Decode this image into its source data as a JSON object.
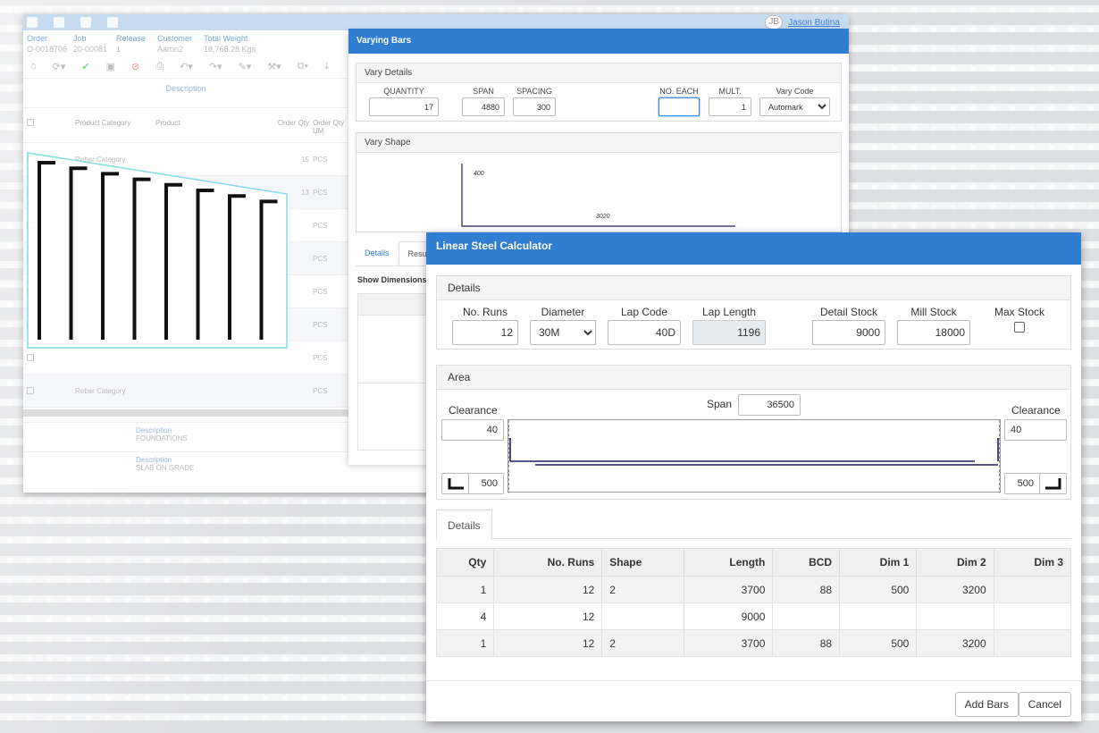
{
  "background_app": {
    "user_initials": "JB",
    "user_name": "Jason Butina",
    "order_headers": [
      "Order",
      "Job",
      "Release",
      "Customer",
      "Total Weight"
    ],
    "order_values": [
      "O-0018706",
      "20-00081",
      "1",
      "Aaron2",
      "18,768.28 Kgs"
    ],
    "description_label": "Description",
    "grid_headers": [
      "",
      "",
      "Product Category",
      "Product",
      "Order Qty",
      "Order Qty UM"
    ],
    "grid_rows": [
      {
        "category": "Rebar Category",
        "qty": "15",
        "um": "PCS"
      },
      {
        "category": "",
        "qty": "13",
        "um": "PCS"
      },
      {
        "category": "",
        "qty": "",
        "um": "PCS"
      },
      {
        "category": "",
        "qty": "",
        "um": "PCS"
      },
      {
        "category": "",
        "qty": "",
        "um": "PCS"
      },
      {
        "category": "",
        "qty": "",
        "um": "PCS"
      },
      {
        "category": "",
        "qty": "",
        "um": "PCS"
      },
      {
        "category": "Rebar Category",
        "qty": "",
        "um": "PCS"
      }
    ],
    "bottom_desc_1_label": "Description",
    "bottom_desc_1_value": "FOUNDATIONS",
    "bottom_desc_2_label": "Description",
    "bottom_desc_2_value": "SLAB ON GRADE"
  },
  "varying_bars": {
    "title": "Varying Bars",
    "vary_details": {
      "header": "Vary Details",
      "quantity_label": "QUANTITY",
      "quantity": "17",
      "span_label": "SPAN",
      "span": "4880",
      "spacing_label": "SPACING",
      "spacing": "300",
      "no_each_label": "NO. EACH",
      "no_each": "",
      "mult_label": "MULT.",
      "mult": "1",
      "vary_code_label": "Vary Code",
      "vary_code": "Automark"
    },
    "vary_shape": {
      "header": "Vary Shape",
      "dim_vertical": "400",
      "dim_horizontal": "3020"
    },
    "tabs": [
      "Details",
      "Resu"
    ],
    "show_dimensions": "Show Dimensions"
  },
  "calculator": {
    "title": "Linear Steel Calculator",
    "details": {
      "header": "Details",
      "no_runs_label": "No. Runs",
      "no_runs": "12",
      "diameter_label": "Diameter",
      "diameter": "30M",
      "lap_code_label": "Lap Code",
      "lap_code": "40D",
      "lap_length_label": "Lap Length",
      "lap_length": "1196",
      "detail_stock_label": "Detail Stock",
      "detail_stock": "9000",
      "mill_stock_label": "Mill Stock",
      "mill_stock": "18000",
      "max_stock_label": "Max Stock"
    },
    "area": {
      "header": "Area",
      "span_label": "Span",
      "span": "36500",
      "clearance_left_label": "Clearance",
      "clearance_left": "40",
      "clearance_right_label": "Clearance",
      "clearance_right": "40",
      "hook_left": "500",
      "hook_right": "500"
    },
    "tab": "Details",
    "table": {
      "headers": [
        "Qty",
        "No. Runs",
        "Shape",
        "Length",
        "BCD",
        "Dim 1",
        "Dim 2",
        "Dim 3"
      ],
      "rows": [
        [
          "1",
          "12",
          "2",
          "3700",
          "88",
          "500",
          "3200",
          ""
        ],
        [
          "4",
          "12",
          "",
          "9000",
          "",
          "",
          "",
          ""
        ],
        [
          "1",
          "12",
          "2",
          "3700",
          "88",
          "500",
          "3200",
          ""
        ]
      ]
    },
    "add_bars": "Add Bars",
    "cancel": "Cancel"
  },
  "colors": {
    "accent": "#2f7ed1",
    "bar_line": "#1f1f5a",
    "preview_outline": "#7fdde3"
  }
}
